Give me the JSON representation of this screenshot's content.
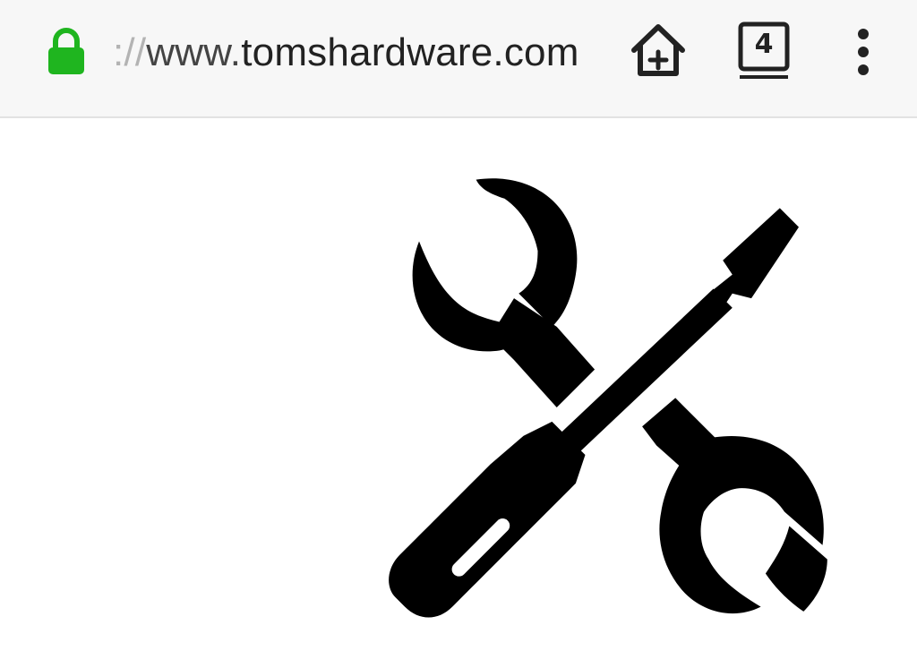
{
  "browser": {
    "url": {
      "scheme": "://",
      "host_prefix": "www.",
      "domain": "tomshardware.com"
    },
    "tab_count": "4",
    "secure_color": "#1fb51f"
  },
  "icons": {
    "secure": "lock-icon",
    "add_to_home": "home-add-icon",
    "tabs": "tab-switcher-icon",
    "menu": "overflow-menu-icon",
    "content_image": "wrench-screwdriver-icon"
  }
}
